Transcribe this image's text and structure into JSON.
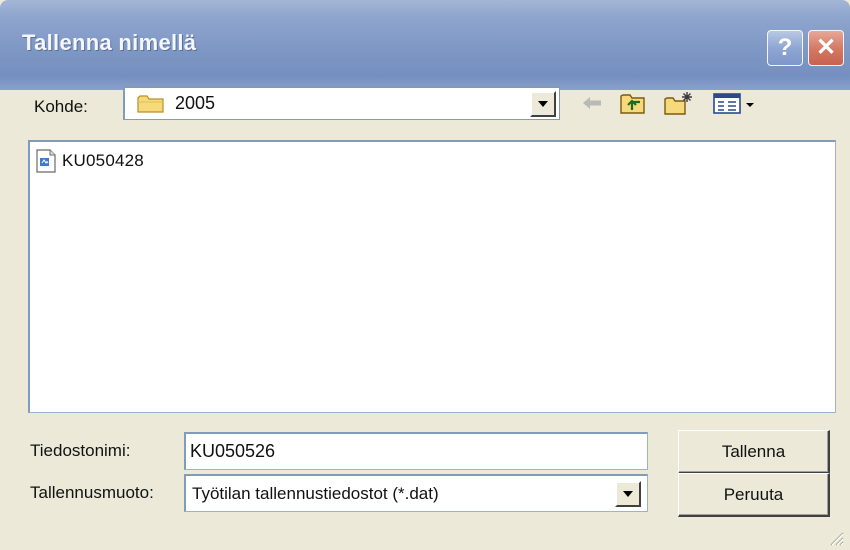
{
  "window": {
    "title": "Tallenna nimellä",
    "help_label": "?",
    "close_label": "✕"
  },
  "toolbar": {
    "lookin_label": "Kohde:",
    "lookin_value": "2005",
    "back_icon": "back-arrow-icon",
    "up_icon": "up-one-level-icon",
    "new_folder_icon": "new-folder-icon",
    "views_icon": "views-menu-icon"
  },
  "file_list": {
    "items": [
      {
        "name": "KU050428",
        "icon": "document-icon"
      }
    ]
  },
  "form": {
    "filename_label": "Tiedostonimi:",
    "filename_value": "KU050526",
    "filetype_label": "Tallennusmuoto:",
    "filetype_value": "Työtilan tallennustiedostot (*.dat)"
  },
  "buttons": {
    "save_label": "Tallenna",
    "cancel_label": "Peruuta"
  },
  "colors": {
    "titlebar": "#7E97C4",
    "dialog_bg": "#ECE9D8",
    "field_border": "#7F9DB9",
    "close_button": "#D47A66"
  }
}
